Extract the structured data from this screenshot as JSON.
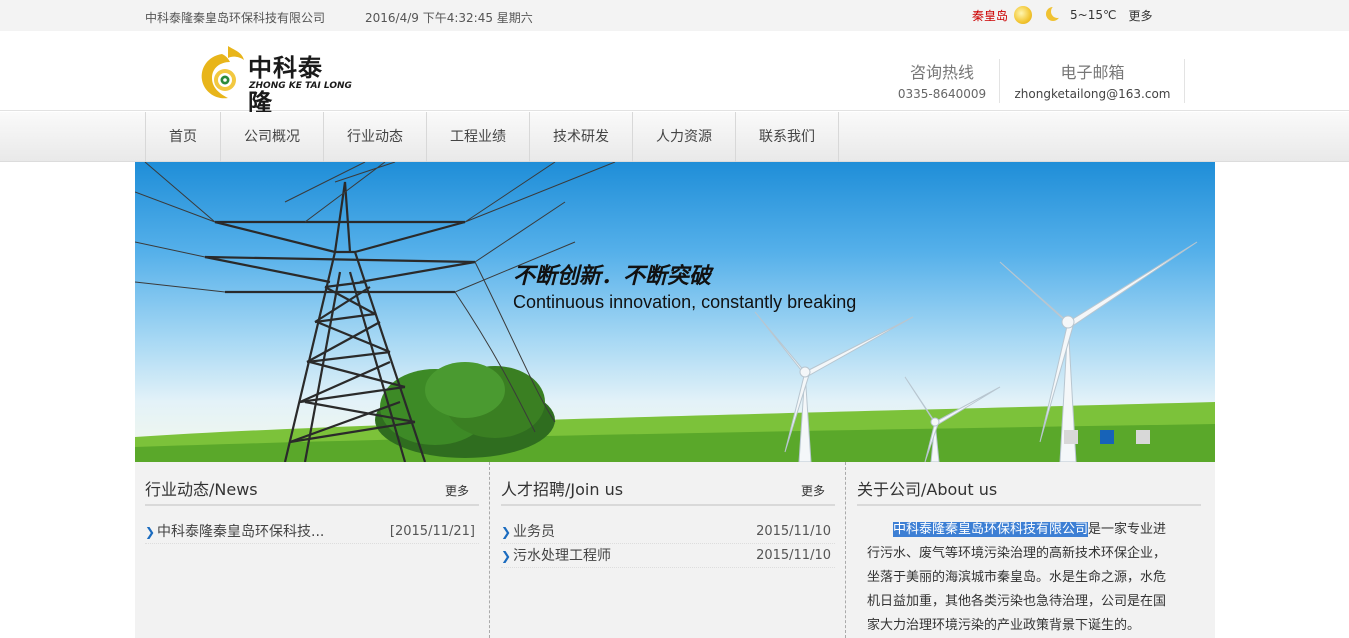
{
  "topbar": {
    "company": "中科泰隆秦皇岛环保科技有限公司",
    "datetime": "2016/4/9 下午4:32:45 星期六",
    "city": "秦皇岛",
    "day_icon": "sun-icon",
    "night_icon": "moon-icon",
    "temperature": "5~15℃",
    "more": "更多"
  },
  "logo": {
    "cn": "中科泰隆",
    "en": "ZHONG KE TAI LONG",
    "colors": {
      "ring": "#e8b51a",
      "center": "#2a8a3a"
    }
  },
  "contact": {
    "hotline_label": "咨询热线",
    "hotline": "0335-8640009",
    "email_label": "电子邮箱",
    "email": "zhongketailong@163.com"
  },
  "nav": {
    "items": [
      "首页",
      "公司概况",
      "行业动态",
      "工程业绩",
      "技术研发",
      "人力资源",
      "联系我们"
    ]
  },
  "banner": {
    "slogan_cn": "不断创新．不断突破",
    "slogan_en": "Continuous innovation, constantly breaking",
    "active_slide": 2,
    "slide_count": 3
  },
  "news": {
    "title": "行业动态/News",
    "more": "更多",
    "items": [
      {
        "text": "中科泰隆秦皇岛环保科技...",
        "date": "[2015/11/21]"
      }
    ]
  },
  "jobs": {
    "title": "人才招聘/Join us",
    "more": "更多",
    "items": [
      {
        "text": "业务员",
        "date": "2015/11/10"
      },
      {
        "text": "污水处理工程师",
        "date": "2015/11/10"
      }
    ]
  },
  "about": {
    "title": "关于公司/About us",
    "highlight": "中科泰隆秦皇岛环保科技有限公司",
    "body": "是一家专业进行污水、废气等环境污染治理的高新技术环保企业，坐落于美丽的海滨城市秦皇岛。水是生命之源，水危机日益加重，其他各类污染也急待治理，公司是在国家大力治理环境污染的产业政策背景下诞生的。"
  },
  "colors": {
    "accent": "#1763b8",
    "city": "#cc0000"
  }
}
